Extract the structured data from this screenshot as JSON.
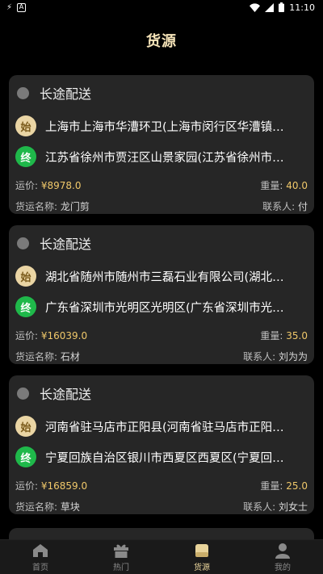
{
  "status_bar": {
    "time": "11:10",
    "left_icons": [
      "bolt-icon",
      "a-box-icon"
    ],
    "right_icons": [
      "wifi-icon",
      "signal-icon",
      "battery-icon"
    ]
  },
  "header": {
    "title": "货源"
  },
  "cards": [
    {
      "type": "长途配送",
      "start_badge": "始",
      "start": "上海市上海市华漕环卫(上海市闵行区华漕镇…",
      "end_badge": "终",
      "end": "江苏省徐州市贾汪区山景家园(江苏省徐州市…",
      "price_label": "运价: ",
      "price": "¥8978.0",
      "weight_label": "重量: ",
      "weight": "40.0",
      "name_label": "货运名称: ",
      "name": "龙门剪",
      "contact_label": "联系人: ",
      "contact": "付"
    },
    {
      "type": "长途配送",
      "start_badge": "始",
      "start": "湖北省随州市随州市三磊石业有限公司(湖北…",
      "end_badge": "终",
      "end": "广东省深圳市光明区光明区(广东省深圳市光…",
      "price_label": "运价: ",
      "price": "¥16039.0",
      "weight_label": "重量: ",
      "weight": "35.0",
      "name_label": "货运名称: ",
      "name": "石材",
      "contact_label": "联系人: ",
      "contact": "刘为为"
    },
    {
      "type": "长途配送",
      "start_badge": "始",
      "start": "河南省驻马店市正阳县(河南省驻马店市正阳…",
      "end_badge": "终",
      "end": "宁夏回族自治区银川市西夏区西夏区(宁夏回…",
      "price_label": "运价: ",
      "price": "¥16859.0",
      "weight_label": "重量: ",
      "weight": "25.0",
      "name_label": "货运名称: ",
      "name": "草块",
      "contact_label": "联系人: ",
      "contact": "刘女士"
    }
  ],
  "tabs": [
    {
      "label": "首页",
      "icon": "home-icon"
    },
    {
      "label": "热门",
      "icon": "gift-icon"
    },
    {
      "label": "货源",
      "icon": "cargo-icon",
      "active": true
    },
    {
      "label": "我的",
      "icon": "user-icon"
    }
  ],
  "colors": {
    "background": "#000000",
    "card": "#262626",
    "gold": "#f0c86a",
    "active_tab": "#e8d39a",
    "start_badge": "#ead5a4",
    "end_badge": "#1fb84a"
  }
}
